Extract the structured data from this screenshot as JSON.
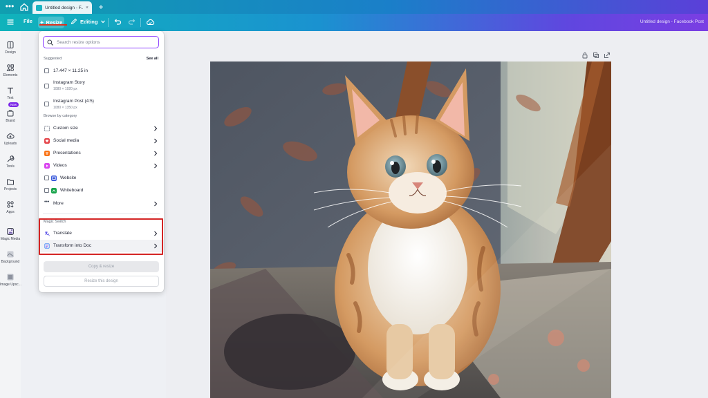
{
  "browser": {
    "tab_title": "Untitled design - F...",
    "tab_close": "×",
    "new_tab": "+"
  },
  "toolbar": {
    "file_label": "File",
    "resize_label": "Resize",
    "editing_label": "Editing",
    "design_title": "Untitled design - Facebook Post"
  },
  "sidebar": {
    "items": [
      {
        "label": "Design",
        "icon": "design-icon"
      },
      {
        "label": "Elements",
        "icon": "elements-icon"
      },
      {
        "label": "Text",
        "icon": "text-icon"
      },
      {
        "label": "Brand",
        "icon": "brand-icon",
        "badge": "New"
      },
      {
        "label": "Uploads",
        "icon": "uploads-icon"
      },
      {
        "label": "Tools",
        "icon": "tools-icon"
      },
      {
        "label": "Projects",
        "icon": "projects-icon"
      },
      {
        "label": "Apps",
        "icon": "apps-icon"
      },
      {
        "label": "Magic Media",
        "icon": "magic-media-icon"
      },
      {
        "label": "Background",
        "icon": "background-icon"
      },
      {
        "label": "Image Upsc...",
        "icon": "image-upscaler-icon"
      }
    ]
  },
  "resize_panel": {
    "search_placeholder": "Search resize options",
    "suggested_label": "Suggested",
    "see_all_label": "See all",
    "suggested": [
      {
        "title": "17.447 × 11.25 in",
        "subtitle": ""
      },
      {
        "title": "Instagram Story",
        "subtitle": "1080 × 1920 px"
      },
      {
        "title": "Instagram Post (4:5)",
        "subtitle": "1080 × 1350 px"
      }
    ],
    "browse_label": "Browse by category",
    "categories": [
      {
        "label": "Custom size",
        "icon": "custom-size-icon",
        "color": "#6b7280"
      },
      {
        "label": "Social media",
        "icon": "heart-icon",
        "color": "#e5484d"
      },
      {
        "label": "Presentations",
        "icon": "presentation-icon",
        "color": "#f97316"
      },
      {
        "label": "Videos",
        "icon": "video-icon",
        "color": "#d946ef"
      },
      {
        "label": "Website",
        "icon": "website-icon",
        "color": "#3b5bdb"
      },
      {
        "label": "Whiteboard",
        "icon": "whiteboard-icon",
        "color": "#16a34a"
      },
      {
        "label": "More",
        "icon": "more-icon",
        "color": "#374151"
      }
    ],
    "magic_switch_label": "Magic Switch",
    "magic_items": [
      {
        "label": "Translate",
        "icon": "translate-icon",
        "color": "#4f46e5"
      },
      {
        "label": "Transform into Doc",
        "icon": "doc-transform-icon",
        "color": "#3b82f6"
      }
    ],
    "copy_resize_label": "Copy & resize",
    "resize_design_label": "Resize this design"
  },
  "colors": {
    "accent": "#8b3dff",
    "highlight_box": "#d42525",
    "topbar_start": "#10b3bb",
    "topbar_end": "#7a3ee3"
  }
}
